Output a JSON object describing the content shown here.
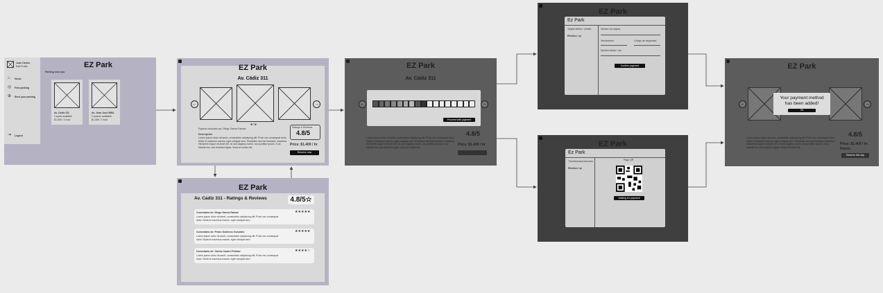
{
  "app_title": "EZ Park",
  "home": {
    "user_name": "Juan Carlos",
    "edit_profile": "Edit Profile",
    "menu": [
      "Home",
      "Find parking",
      "Rent your parking"
    ],
    "logout": "Logout",
    "section": "Parking near you",
    "cards": [
      {
        "title": "Av. Cádiz 311",
        "spots": "1 spots available",
        "price": "$1.400 / 1 hour"
      },
      {
        "title": "Av. Juan José 556A",
        "spots": "2 spaces available",
        "price": "$1.400 / 1 hour"
      }
    ]
  },
  "detail": {
    "address": "Av. Cádiz 311",
    "uploaded_by": "Espacio ofuscado por: Diego García Ramos",
    "description_title": "Descripción",
    "description": "Lorem ipsum dolor sit amet, consectetur adipiscing elit. Proin nec consequat dolor. Nulla et maximus mauris, eget volutpat sem. Phasellus sed est tincidunt, maximus Hendrerit neque sit amet elit. Ut sed dapibus lorem, non porttitor ipsum. In at blandit nisi, sed tincidunt ligula. Nunc et mollis nisi.",
    "ratings_label": "Ratings & Reviews",
    "rating": "4.8/5",
    "price": "Price: $1.400 / hr",
    "reserve": "Reserve now",
    "hours_label": "Hours:"
  },
  "reviews": {
    "heading": "Av. Cádiz 311 - Ratings & Reviews",
    "rating": "4.8/5",
    "items": [
      {
        "author": "Comentario de: Diego García Ramos",
        "stars": "★★★★★",
        "text": "Lorem ipsum dolor sit amet, consectetur adipiscing elit. Proin nec consequat dolor. Nulla et maximus mauris, eget volutpat sem."
      },
      {
        "author": "Comentario de: Pedro Gutiérrez Gonzalez",
        "stars": "★★★★★",
        "text": "Lorem ipsum dolor sit amet, consectetur adipiscing elit. Proin nec consequat dolor. Nulla et maximus mauris, eget volutpat sem."
      },
      {
        "author": "Comentario de: Carlos Castro Peñaloz",
        "stars": "★★★★☆",
        "text": "Lorem ipsum dolor sit amet, consectetur adipiscing elit. Proin nec consequat dolor. Nulla et maximus mauris, eget volutpat sem."
      }
    ]
  },
  "hours_modal": {
    "confirm": "Proceed with payment"
  },
  "card_modal": {
    "title": "Ez Park",
    "tab1": "Tarjeta débito / crédito",
    "tab2": "Efectivo / qr",
    "card_number": "Número de tarjeta",
    "expiry": "Vencimiento",
    "cvv": "Código de seguridad",
    "name": "Nombre titular / cta",
    "confirm": "Confirm payment"
  },
  "qr_modal": {
    "title": "Ez Park",
    "tab1": "Transferencia bancaria",
    "tab2": "Efectivo / qr",
    "qr_label": "Pago QR",
    "waiting": "Waiting for payment"
  },
  "success": {
    "message": "Your payment method has been added!",
    "ok": "Ok",
    "rating": "4.8/5",
    "price": "Price: $1.400 / hr",
    "hours": "Hours:",
    "reserve": "Reserve this day"
  }
}
